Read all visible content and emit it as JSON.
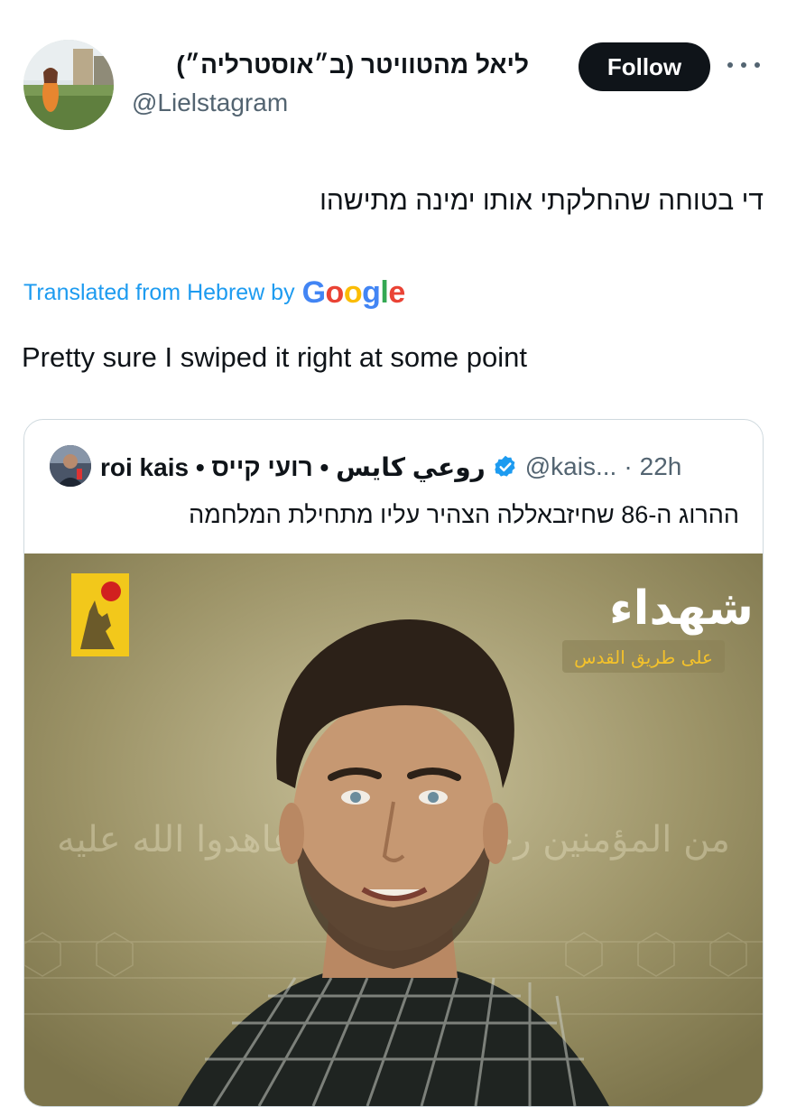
{
  "author": {
    "display_name": "ליאל מהטוויטר (ב״אוסטרליה״)",
    "handle": "@Lielstagram"
  },
  "actions": {
    "follow_label": "Follow",
    "more_icon": "more-horizontal-icon"
  },
  "tweet": {
    "text_original": "די בטוחה שהחלקתי אותו ימינה מתישהו",
    "translated_from": "Translated from Hebrew by",
    "translation_provider": "Google",
    "text_translated": "Pretty sure I swiped it right at some point"
  },
  "quote": {
    "name": "roi kais • روعي كايس • רועי קייס",
    "verified_icon": "verified-badge-icon",
    "handle": "@kais...",
    "separator": "·",
    "time": "22h",
    "text": "ההרוג ה-86 שחיזבאללה הצהיר עליו מתחילת המלחמה",
    "image": {
      "headline": "شهداء",
      "subheadline": "على طريق القدس",
      "calligraphy": "من المؤمنين رجال صدقوا ما عاهدوا الله عليه"
    }
  },
  "colors": {
    "link": "#1d9bf0",
    "secondary_text": "#536471",
    "follow_bg": "#0f1419",
    "verified": "#1d9bf0",
    "poster_bg": "#8f8759",
    "flag_yellow": "#f2c81b"
  }
}
